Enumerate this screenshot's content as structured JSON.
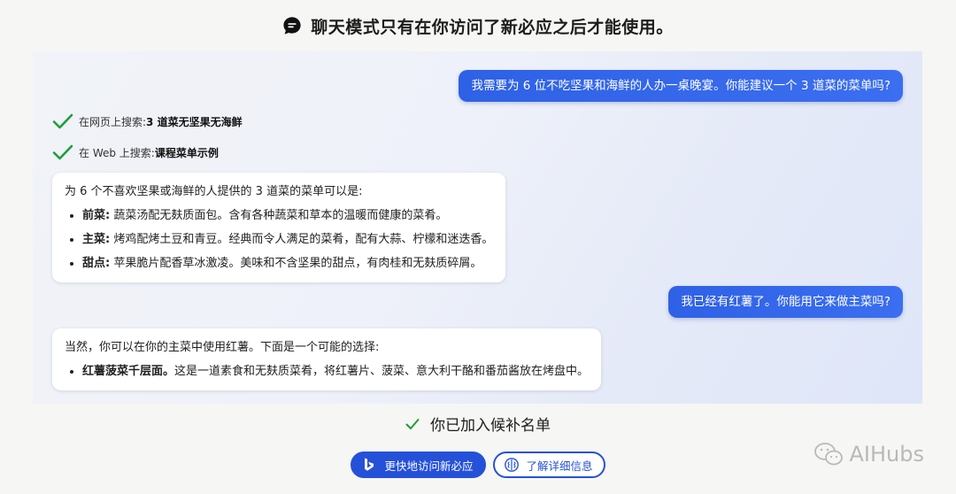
{
  "header": {
    "title": "聊天模式只有在你访问了新必应之后才能使用。"
  },
  "chat": {
    "user_message_1": "我需要为 6 位不吃坚果和海鲜的人办一桌晚宴。你能建议一个 3 道菜的菜单吗?",
    "search_1": {
      "prefix": "在网页上搜索: ",
      "query": "3 道菜无坚果无海鲜"
    },
    "search_2": {
      "prefix": "在 Web 上搜索: ",
      "query": "课程菜单示例"
    },
    "bot_message_1": {
      "intro": "为 6 个不喜欢坚果或海鲜的人提供的 3 道菜的菜单可以是:",
      "items": [
        {
          "label": "前菜:",
          "text": " 蔬菜汤配无麸质面包。含有各种蔬菜和草本的温暖而健康的菜肴。"
        },
        {
          "label": "主菜:",
          "text": " 烤鸡配烤土豆和青豆。经典而令人满足的菜肴，配有大蒜、柠檬和迷迭香。"
        },
        {
          "label": "甜点:",
          "text": " 苹果脆片配香草冰激凌。美味和不含坚果的甜点，有肉桂和无麸质碎屑。"
        }
      ]
    },
    "user_message_2": "我已经有红薯了。你能用它来做主菜吗?",
    "bot_message_2": {
      "intro": "当然，你可以在你的主菜中使用红薯。下面是一个可能的选择:",
      "items": [
        {
          "label": "红薯菠菜千层面。",
          "text": "这是一道素食和无麸质菜肴，将红薯片、菠菜、意大利干酪和番茄酱放在烤盘中。"
        }
      ]
    }
  },
  "footer": {
    "status": "你已加入候补名单",
    "primary_button": "更快地访问新必应",
    "secondary_button": "了解详细信息"
  },
  "watermark": {
    "text": "AIHubs"
  },
  "colors": {
    "accent_blue": "#2551d9",
    "user_bubble": "#3366ea",
    "check_green": "#1f9d3a"
  },
  "icons": [
    "chat-bubble-icon",
    "checkmark-icon",
    "bing-logo-icon",
    "brain-icon",
    "wechat-icon"
  ]
}
